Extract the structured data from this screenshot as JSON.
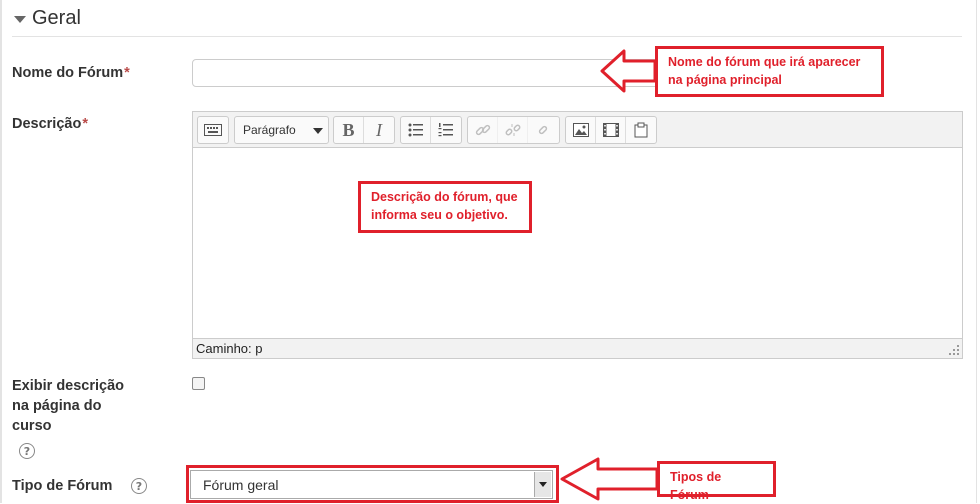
{
  "section": {
    "title": "Geral"
  },
  "fields": {
    "name_label": "Nome do Fórum",
    "required_mark": "*",
    "description_label": "Descrição",
    "show_description_label_line1": "Exibir descrição",
    "show_description_label_line2": "na página do",
    "show_description_label_line3": "curso",
    "forum_type_label": "Tipo de Fórum",
    "help_glyph": "?"
  },
  "editor": {
    "format_value": "Parágrafo",
    "bold_glyph": "B",
    "italic_glyph": "I",
    "path_text": "Caminho: p",
    "toolbar_icons": [
      "keyboard-icon",
      "bullet-list-icon",
      "numbered-list-icon",
      "link-icon",
      "unlink-icon",
      "anchor-icon",
      "image-icon",
      "media-icon",
      "paste-icon"
    ]
  },
  "forum_type": {
    "selected": "Fórum geral"
  },
  "annotations": {
    "name_note_line1": "Nome do fórum que irá aparecer",
    "name_note_line2": "na página  principal",
    "description_note_line1": "Descrição do fórum, que",
    "description_note_line2": "informa seu o objetivo.",
    "type_note": "Tipos de Fórum"
  },
  "colors": {
    "annotation_red": "#e0202b",
    "required_red": "#b94a48"
  }
}
